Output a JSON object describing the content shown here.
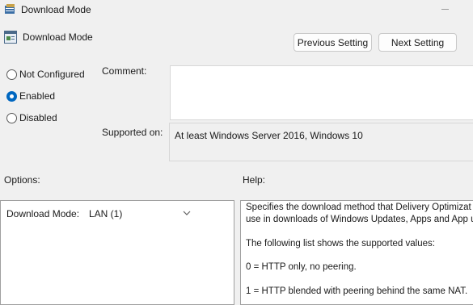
{
  "window": {
    "title": "Download Mode"
  },
  "header": {
    "setting_name": "Download Mode",
    "previous_label": "Previous Setting",
    "next_label": "Next Setting"
  },
  "state": {
    "options": [
      "Not Configured",
      "Enabled",
      "Disabled"
    ],
    "selected": "Enabled"
  },
  "comment": {
    "label": "Comment:",
    "value": ""
  },
  "supported": {
    "label": "Supported on:",
    "value": "At least Windows Server 2016, Windows 10"
  },
  "options_section": {
    "title": "Options:",
    "download_mode_label": "Download Mode:",
    "download_mode_value": "LAN (1)"
  },
  "help_section": {
    "title": "Help:",
    "lines": [
      "Specifies the download method that Delivery Optimizat",
      "use in downloads of Windows Updates, Apps and App u",
      "The following list shows the supported values:",
      "0 = HTTP only, no peering.",
      "1 = HTTP blended with peering behind the same NAT."
    ]
  },
  "colors": {
    "accent": "#0067c0",
    "background": "#f0f0f0"
  }
}
